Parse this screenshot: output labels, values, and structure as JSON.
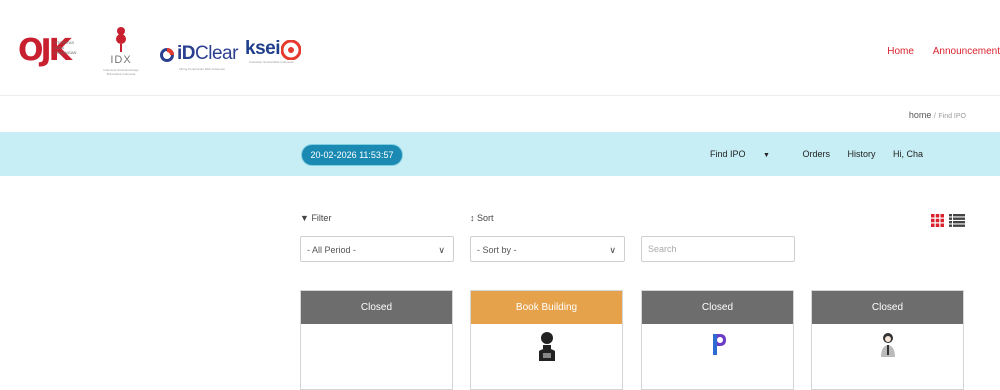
{
  "header": {
    "logos": {
      "ojk": {
        "letters": "OJK",
        "subtext": "OTORITAS JASA KEUANGAN"
      },
      "idx": {
        "text": "IDX",
        "subtext": "Indonesia Stock Exchange Bursa Efek Indonesia"
      },
      "idclear": {
        "brand_bold": "iD",
        "brand_rest": "Clear",
        "subtext": "Kliring Penjaminan Efek Indonesia"
      },
      "ksei": {
        "text": "ksei",
        "subtext": "Kustodian Sentral Efek Indonesia"
      }
    },
    "nav": {
      "home": "Home",
      "announcement": "Announcement"
    }
  },
  "breadcrumb": {
    "home": "home",
    "separator": "/",
    "current": "Find IPO"
  },
  "menubar": {
    "datetime": "20-02-2026 11:53:57",
    "find_ipo": "Find IPO",
    "orders": "Orders",
    "history": "History",
    "greeting": "Hi, Cha"
  },
  "filters": {
    "filter_label": "Filter",
    "sort_label": "Sort",
    "period_selected": "- All Period -",
    "sort_selected": "- Sort by -",
    "search_placeholder": "Search"
  },
  "icons": {
    "filter": "funnel-icon",
    "sort": "sort-icon",
    "grid_view": "grid-view-icon",
    "list_view": "list-view-icon",
    "caret": "chevron-down-icon"
  },
  "cards": [
    {
      "status": "Closed",
      "status_type": "closed"
    },
    {
      "status": "Book Building",
      "status_type": "book"
    },
    {
      "status": "Closed",
      "status_type": "closed"
    },
    {
      "status": "Closed",
      "status_type": "closed"
    }
  ],
  "colors": {
    "brand_red": "#d9232e",
    "menubar_bg": "#c6eef4",
    "datetime_pill": "#1b8ab3",
    "status_closed": "#6d6d6d",
    "status_book_building": "#e5a24a",
    "grid_icon": "#d9232e"
  }
}
